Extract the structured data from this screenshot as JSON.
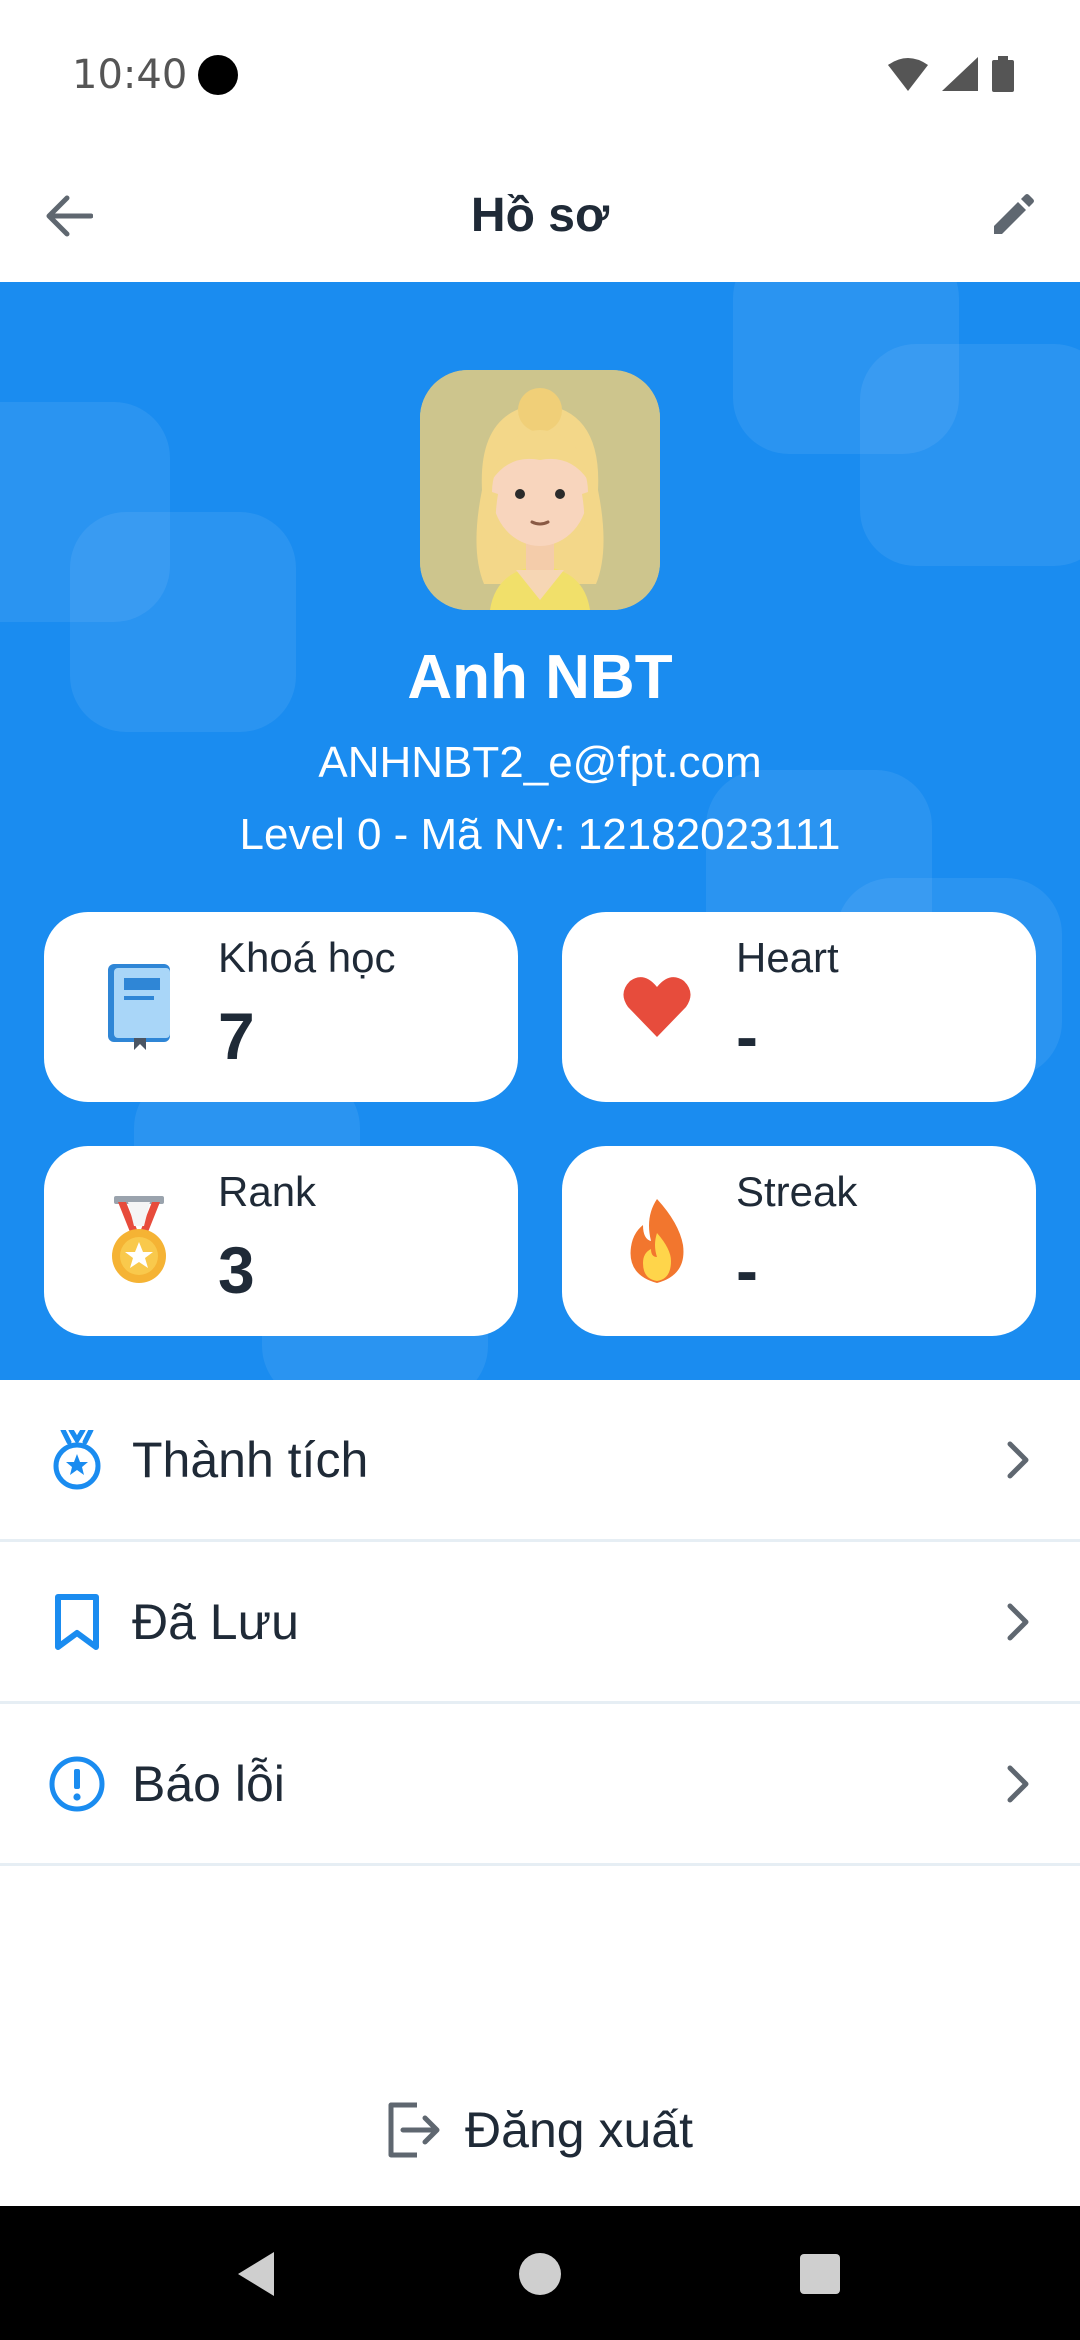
{
  "status_bar": {
    "time": "10:40"
  },
  "app_bar": {
    "title": "Hồ sơ",
    "back_icon": "arrow-left-icon",
    "edit_icon": "pencil-icon"
  },
  "profile": {
    "name": "Anh NBT",
    "email": "ANHNBT2_e@fpt.com",
    "level_line": "Level 0 - Mã NV: 12182023111"
  },
  "stats": [
    {
      "label": "Khoá học",
      "value": "7",
      "icon": "book-icon"
    },
    {
      "label": "Heart",
      "value": "-",
      "icon": "heart-icon"
    },
    {
      "label": "Rank",
      "value": "3",
      "icon": "medal-icon"
    },
    {
      "label": "Streak",
      "value": "-",
      "icon": "fire-icon"
    }
  ],
  "menu": [
    {
      "label": "Thành tích",
      "icon": "achievement-icon"
    },
    {
      "label": "Đã Lưu",
      "icon": "bookmark-icon"
    },
    {
      "label": "Báo lỗi",
      "icon": "alert-circle-icon"
    }
  ],
  "logout": {
    "label": "Đăng xuất",
    "icon": "logout-icon"
  },
  "colors": {
    "primary": "#1a8cf0",
    "accent_icon": "#1a8cf0",
    "heart": "#e74c3c",
    "text": "#1f2a37"
  }
}
